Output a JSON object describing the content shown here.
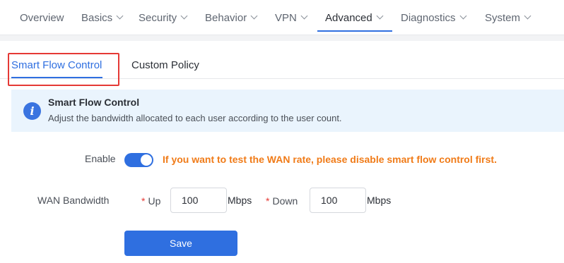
{
  "nav": {
    "items": [
      {
        "label": "Overview",
        "has_dropdown": false
      },
      {
        "label": "Basics",
        "has_dropdown": true
      },
      {
        "label": "Security",
        "has_dropdown": true
      },
      {
        "label": "Behavior",
        "has_dropdown": true
      },
      {
        "label": "VPN",
        "has_dropdown": true
      },
      {
        "label": "Advanced",
        "has_dropdown": true,
        "active": true
      },
      {
        "label": "Diagnostics",
        "has_dropdown": true
      },
      {
        "label": "System",
        "has_dropdown": true
      }
    ]
  },
  "tabs": [
    {
      "label": "Smart Flow Control",
      "active": true
    },
    {
      "label": "Custom Policy",
      "active": false
    }
  ],
  "info": {
    "icon": "info-icon",
    "icon_glyph": "i",
    "title": "Smart Flow Control",
    "description": "Adjust the bandwidth allocated to each user according to the user count."
  },
  "form": {
    "enable_label": "Enable",
    "enable_on": true,
    "warning": "If you want to test the WAN rate, please disable smart flow control first.",
    "wan_label": "WAN Bandwidth",
    "required_mark": "*",
    "up_label": "Up",
    "up_value": "100",
    "up_unit": "Mbps",
    "down_label": "Down",
    "down_value": "100",
    "down_unit": "Mbps",
    "save_label": "Save"
  },
  "colors": {
    "accent": "#2f6fe0",
    "warning": "#f07b18",
    "highlight": "#e53935",
    "info_bg": "#eaf4fd"
  }
}
